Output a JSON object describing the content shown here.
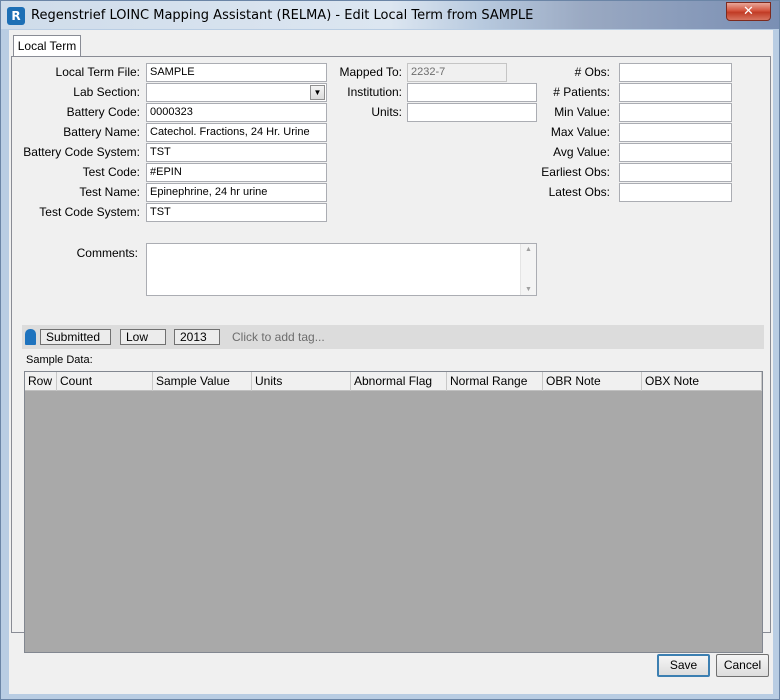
{
  "window": {
    "title": "Regenstrief LOINC Mapping Assistant (RELMA) - Edit Local Term from SAMPLE",
    "close_glyph": "✕"
  },
  "tab": {
    "label": "Local Term"
  },
  "left_fields": {
    "local_term_file": {
      "label": "Local Term File:",
      "value": "SAMPLE"
    },
    "lab_section": {
      "label": "Lab Section:",
      "value": ""
    },
    "battery_code": {
      "label": "Battery Code:",
      "value": "0000323"
    },
    "battery_name": {
      "label": "Battery Name:",
      "value": "Catechol. Fractions, 24 Hr. Urine"
    },
    "battery_code_system": {
      "label": "Battery Code System:",
      "value": "TST"
    },
    "test_code": {
      "label": "Test Code:",
      "value": "#EPIN"
    },
    "test_name": {
      "label": "Test Name:",
      "value": "Epinephrine, 24 hr urine"
    },
    "test_code_system": {
      "label": "Test Code System:",
      "value": "TST"
    }
  },
  "middle_fields": {
    "mapped_to": {
      "label": "Mapped To:",
      "value": "2232-7"
    },
    "institution": {
      "label": "Institution:",
      "value": ""
    },
    "units": {
      "label": "Units:",
      "value": ""
    }
  },
  "right_fields": {
    "obs": {
      "label": "# Obs:",
      "value": ""
    },
    "patients": {
      "label": "# Patients:",
      "value": ""
    },
    "min_value": {
      "label": "Min Value:",
      "value": ""
    },
    "max_value": {
      "label": "Max Value:",
      "value": ""
    },
    "avg_value": {
      "label": "Avg Value:",
      "value": ""
    },
    "earliest_obs": {
      "label": "Earliest Obs:",
      "value": ""
    },
    "latest_obs": {
      "label": "Latest Obs:",
      "value": ""
    }
  },
  "comments": {
    "label": "Comments:",
    "value": ""
  },
  "tags": {
    "items": [
      "Submitted",
      "Low",
      "2013"
    ],
    "add_prompt": "Click to add tag..."
  },
  "sample_data": {
    "label": "Sample Data:",
    "columns": [
      "Row",
      "Count",
      "Sample Value",
      "Units",
      "Abnormal Flag",
      "Normal Range",
      "OBR Note",
      "OBX Note"
    ]
  },
  "buttons": {
    "save": "Save",
    "cancel": "Cancel"
  }
}
